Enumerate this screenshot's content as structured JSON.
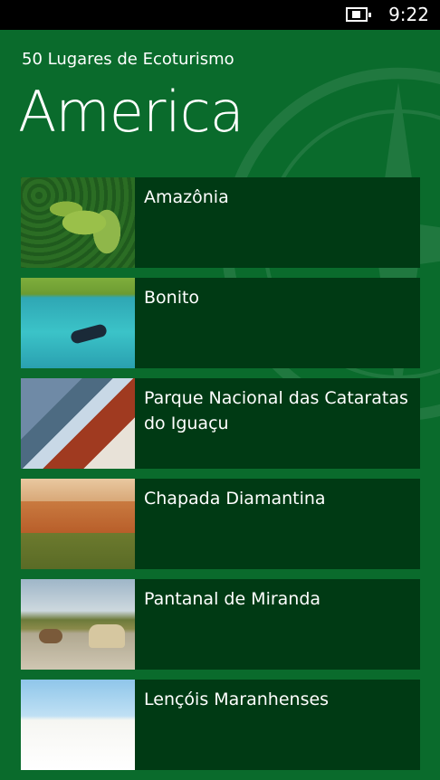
{
  "status_bar": {
    "time": "9:22",
    "battery_icon": "battery-charging-icon"
  },
  "header": {
    "app_name": "50 Lugares de Ecoturismo",
    "page_title": "America"
  },
  "colors": {
    "background": "#0a6b2c",
    "tile": "#003a14",
    "text": "#ffffff"
  },
  "items": [
    {
      "label": "Amazônia",
      "thumb": "amazonia-photo"
    },
    {
      "label": "Bonito",
      "thumb": "bonito-photo"
    },
    {
      "label": "Parque Nacional das Cataratas do Iguaçu",
      "thumb": "iguacu-photo"
    },
    {
      "label": "Chapada Diamantina",
      "thumb": "chapada-photo"
    },
    {
      "label": "Pantanal de Miranda",
      "thumb": "pantanal-photo"
    },
    {
      "label": "Lençóis Maranhenses",
      "thumb": "lencois-photo"
    }
  ]
}
